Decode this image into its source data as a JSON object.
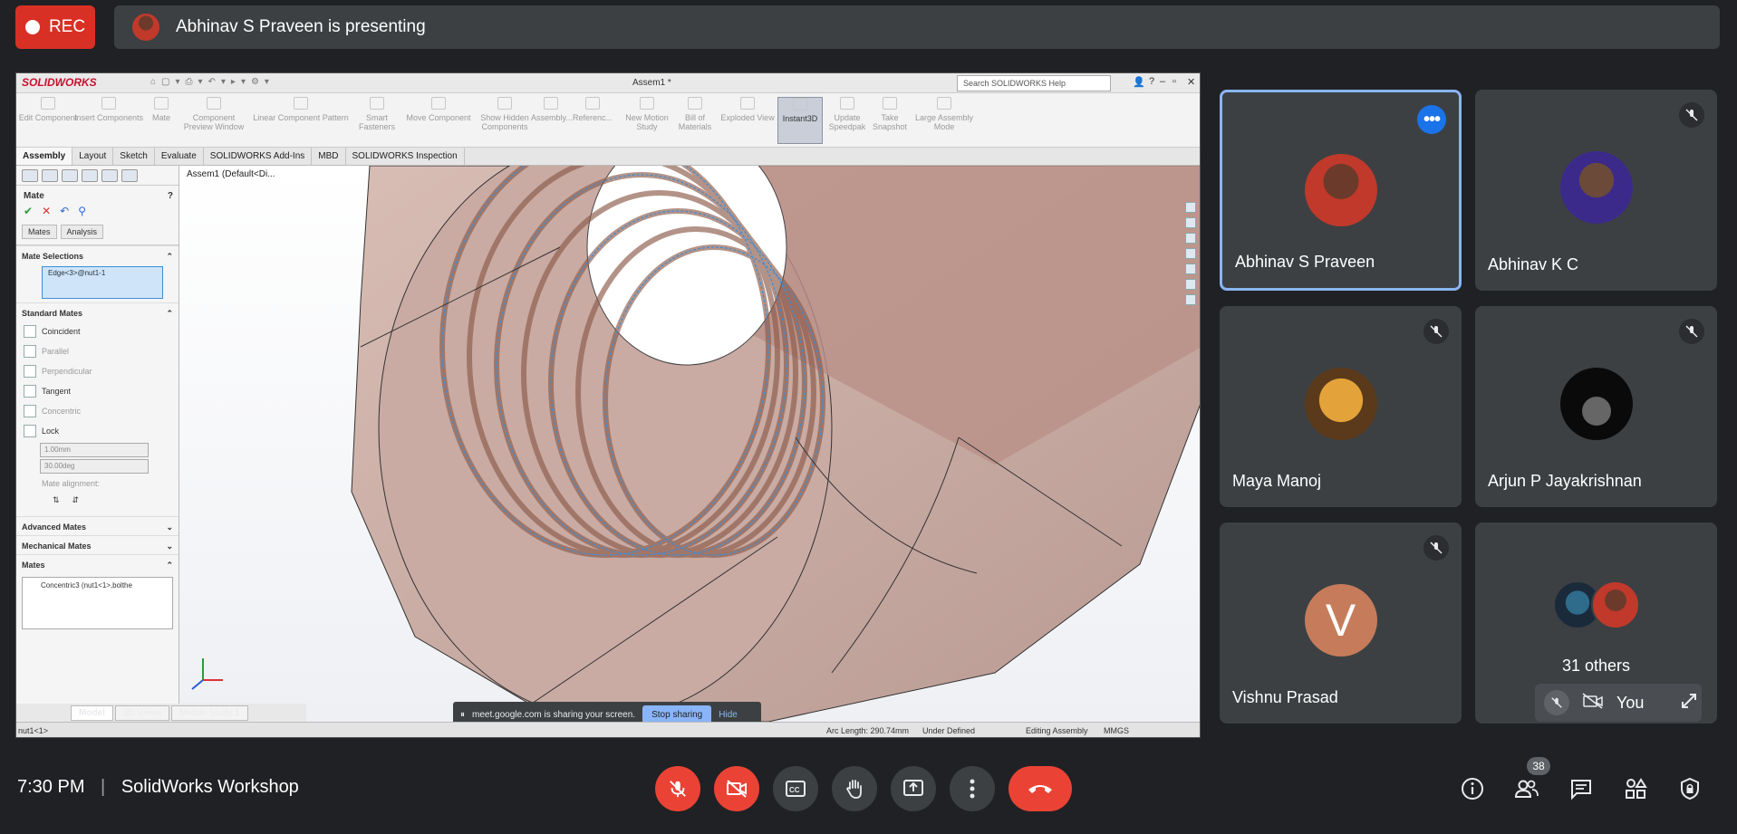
{
  "top": {
    "rec_label": "REC",
    "presenting_text": "Abhinav S Praveen is presenting"
  },
  "solidworks": {
    "logo": "SOLIDWORKS",
    "document_title": "Assem1 *",
    "search_placeholder": "Search SOLIDWORKS Help",
    "ribbon": [
      {
        "label": "Edit Component"
      },
      {
        "label": "Insert Components"
      },
      {
        "label": "Mate"
      },
      {
        "label": "Component Preview Window"
      },
      {
        "label": "Linear Component Pattern"
      },
      {
        "label": "Smart Fasteners"
      },
      {
        "label": "Move Component"
      },
      {
        "label": "Show Hidden Components"
      },
      {
        "label": "Assembly..."
      },
      {
        "label": "Referenc..."
      },
      {
        "label": "New Motion Study"
      },
      {
        "label": "Bill of Materials"
      },
      {
        "label": "Exploded View"
      },
      {
        "label": "Instant3D"
      },
      {
        "label": "Update Speedpak"
      },
      {
        "label": "Take Snapshot"
      },
      {
        "label": "Large Assembly Mode"
      }
    ],
    "tabs": [
      "Assembly",
      "Layout",
      "Sketch",
      "Evaluate",
      "SOLIDWORKS Add-Ins",
      "MBD",
      "SOLIDWORKS Inspection"
    ],
    "feature_tree_root": "Assem1  (Default<Di...",
    "pm": {
      "title": "Mate",
      "subtab_mates": "Mates",
      "subtab_analysis": "Analysis",
      "sec_selections": "Mate Selections",
      "selection_value": "Edge<3>@nut1-1",
      "sec_standard": "Standard Mates",
      "coincident": "Coincident",
      "parallel": "Parallel",
      "perpendicular": "Perpendicular",
      "tangent": "Tangent",
      "concentric": "Concentric",
      "lock": "Lock",
      "distance": "1.00mm",
      "angle": "30.00deg",
      "mate_alignment": "Mate alignment:",
      "sec_advanced": "Advanced Mates",
      "sec_mechanical": "Mechanical Mates",
      "sec_mates": "Mates",
      "mate_item": "Concentric3 (nut1<1>,bolthe"
    },
    "bottom_tabs": [
      "Model",
      "3D Views",
      "Motion Study 1"
    ],
    "status": {
      "left": "nut1<1>",
      "arc": "Arc Length: 290.74mm",
      "defined": "Under Defined",
      "editing": "Editing Assembly",
      "units": "MMGS"
    },
    "share_bar": {
      "text": "meet.google.com is sharing your screen.",
      "stop": "Stop sharing",
      "hide": "Hide"
    }
  },
  "participants": [
    {
      "name": "Abhinav S Praveen"
    },
    {
      "name": "Abhinav K C"
    },
    {
      "name": "Maya Manoj"
    },
    {
      "name": "Arjun P Jayakrishnan"
    },
    {
      "name": "Vishnu Prasad",
      "initial": "V"
    }
  ],
  "others_label": "31 others",
  "you_label": "You",
  "bottom": {
    "time": "7:30 PM",
    "meeting_name": "SolidWorks Workshop",
    "people_count": "38"
  },
  "colors": {
    "accent": "#8ab4f8",
    "danger": "#ea4335",
    "rec": "#d93025",
    "tile": "#3c4043",
    "background": "#202124"
  }
}
